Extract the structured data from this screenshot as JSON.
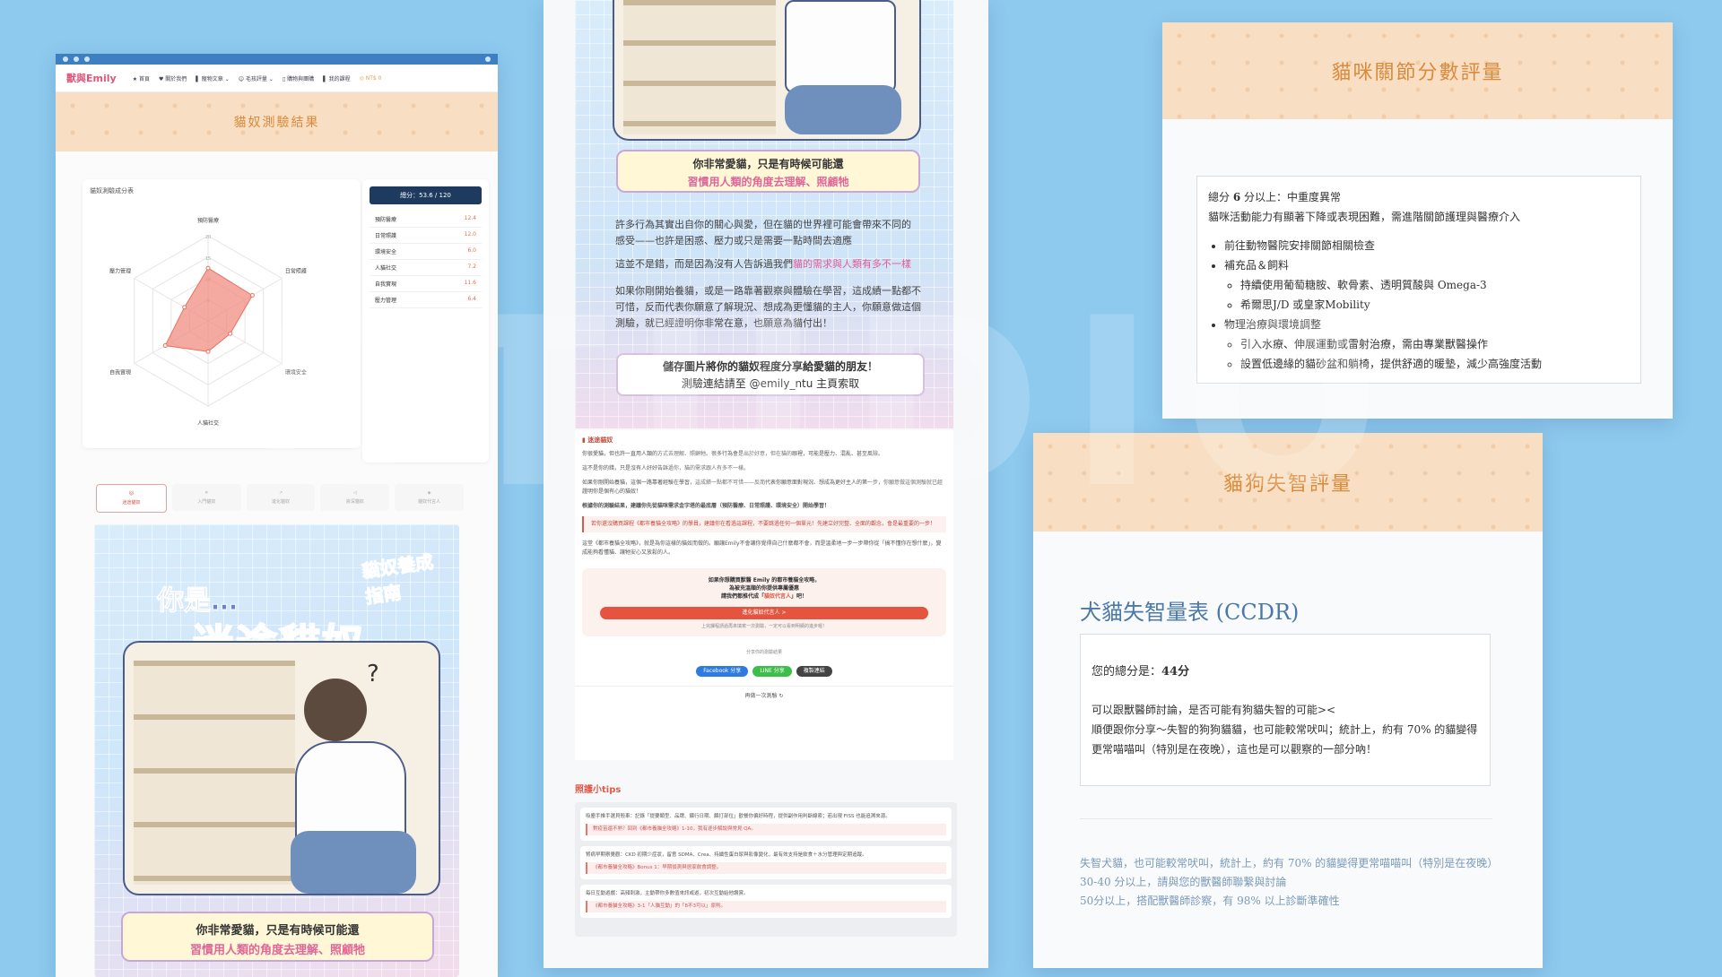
{
  "panel1": {
    "nav": {
      "logo": "獸與Emily",
      "items": [
        "★ 首頁",
        "♥ 關於我們",
        "▌ 寵物文章 ⌄",
        "☺ 毛孩評量 ⌄",
        "▯ 購物與團購",
        "▌ 我的課程",
        "◎ NT$ 0"
      ]
    },
    "banner_title": "貓奴測驗結果",
    "radar": {
      "title": "貓奴測驗成分表",
      "axes": [
        "預防醫療",
        "日常照護",
        "環境安全",
        "人貓社交",
        "自我實現",
        "壓力管理"
      ],
      "values": [
        12.4,
        12.0,
        6.0,
        7.2,
        11.6,
        6.4
      ],
      "max": 20,
      "ticks": [
        "20",
        "15",
        "10",
        "5"
      ]
    },
    "score_total": "總分：53.6 / 120",
    "scores": [
      {
        "label": "預防醫療",
        "value": "12.4"
      },
      {
        "label": "日常照護",
        "value": "12.0"
      },
      {
        "label": "環境安全",
        "value": "6.0"
      },
      {
        "label": "人貓社交",
        "value": "7.2"
      },
      {
        "label": "自我實現",
        "value": "11.6"
      },
      {
        "label": "壓力管理",
        "value": "6.4"
      }
    ],
    "tabs": [
      "迷途貓奴",
      "入門貓奴",
      "進化貓奴",
      "資深貓奴",
      "貓奴代言人"
    ],
    "illus_title_small": "你是…",
    "illus_title_big": "迷途貓奴",
    "illus_badge": "貓奴養成指南",
    "speech_line1": "你非常愛貓，只是有時候可能還",
    "speech_line2": "習慣用人類的角度去理解、照顧牠"
  },
  "panel2": {
    "speech_line1": "你非常愛貓，只是有時候可能還",
    "speech_line2": "習慣用人類的角度去理解、照顧牠",
    "para1": "許多行為其實出自你的關心與愛，但在貓的世界裡可能會帶來不同的感受——也許是困惑、壓力或只是需要一點時間去適應",
    "para2_a": "這並不是錯，而是因為沒有人告訴過我們",
    "para2_b": "貓的需求與人類有多不一樣",
    "para3": "如果你剛開始養貓，或是一路靠著觀察與體驗在學習，這成績一點都不可惜，反而代表你願意了解現況、想成為更懂貓的主人，你願意做這個測驗，就已經證明你非常在意，也願意為貓付出！",
    "share_line1": "儲存圖片將你的貓奴程度分享給愛貓的朋友！",
    "share_line2": "測驗連結請至 @emily_ntu 主頁索取",
    "section_title": "迷途貓奴",
    "small_paras": [
      "你很愛貓，但也許一直用人類的方式去理解、照顧牠。很多行為會是出於好意，但在貓的眼裡，可能是壓力、混亂、甚至風險。",
      "這不是你的錯，只是沒有人好好告訴過你，貓的需求跟人有多不一樣。",
      "如果你剛開始養貓，這個一路靠著經驗在學習，這成績一點都不可惜——反而代表你願意面對現況、想成為更好主人的第一步，你願意做這個測驗就已經證明你是個有心的貓奴！",
      "根據你的測驗結果，建議你先從貓咪需求金字塔的最底層（預防醫療、日常照護、環境安全）開始學習！"
    ],
    "redbar_text": "若你還沒購買課程《都市養貓全攻略》的學員，建議你在看過這課程，不要跳過任何一個單元！先建立好完整、全面的觀念，會是最重要的一步！",
    "small_para_after": "這堂《都市養貓全攻略》，就是為你這樣的貓奴而做的。願讓Emily不會讓你覺得自己什麼都不會，而是溫柔地一步一步帶你從「搞不懂你在想什麼」，變成能夠看懂貓、讓牠安心又放鬆的人。",
    "cta_line1": "如果你想購買獸醫 Emily 的都市養貓全攻略，",
    "cta_line2": "為被充溫順的你提供專屬優惠",
    "cta_line3_a": "請我們都推代成「",
    "cta_line3_b": "貓奴代言人",
    "cta_line3_c": "」吧！",
    "cta_button": "進化貓奴代言人 >",
    "cta_note": "上完課程請過再來填寫一次測驗，一定可以看到明顯的進步喔！",
    "share_label": "分享你的測驗結果",
    "share_buttons": [
      "Facebook 分享",
      "LINE 分享",
      "複製連結"
    ],
    "retry": "再做一次測驗 ↻",
    "tips_title": "照護小tips",
    "tips": [
      {
        "text": "吸塵手推手選貝殼車：記錄「提要類型、品牌、餵行日期、餵打部位」歡餐你偏好時程，提供副作用判斷線索；若出現 FISS 也能追溯來源。",
        "link": "對疫苗還不熟？回到《都市養貓全攻略》1-10，我有逐步解說與常見 QA。"
      },
      {
        "text": "腎病早期察覺觀：CKD 初期少症狀，留意 SDMA、Crea、持續性蛋白尿與影像變化，最有效支持是飲食＋水分管理與定期追蹤。",
        "link": "《都市養貓全攻略》Bonus 1：早期偵測與居家飲食調整。"
      },
      {
        "text": "每日互動遊戲：高頻刺激，主動帶你多數值來訊或遊，初次互動給他讚賞。",
        "link": "《都市養貓全攻略》3-1「人貓互動」的「8不3可以」原則。"
      }
    ]
  },
  "panel3": {
    "banner_title": "貓咪關節分數評量",
    "summary_a": "總分 ",
    "summary_num": "6",
    "summary_b": " 分以上：中重度異常",
    "summary_line2": "貓咪活動能力有顯著下降或表現困難，需進階關節護理與醫療介入",
    "bullets": {
      "b1": "前往動物醫院安排關節相關檢查",
      "b2": "補充品＆飼料",
      "b2a": "持續使用葡萄糖胺、軟骨素、透明質酸與 Omega-3",
      "b2b": "希爾思J/D 或皇家Mobility",
      "b3": "物理治療與環境調整",
      "b3a": "引入水療、伸展運動或雷射治療，需由專業獸醫操作",
      "b3b": "設置低邊緣的貓砂盆和躺椅，提供舒適的暖墊，減少高強度活動"
    }
  },
  "panel4": {
    "banner_title": "貓狗失智評量",
    "heading": "犬貓失智量表 (CCDR)",
    "score_label": "您的總分是：",
    "score_value": "44分",
    "body_line1": "可以跟獸醫師討論，是否可能有狗貓失智的可能><",
    "body_line2": "順便跟你分享～失智的狗狗貓貓，也可能較常吠叫；統計上，約有 70% 的貓變得更常喵喵叫（特別是在夜晚），這也是可以觀察的一部分吶！",
    "footer_lines": [
      "失智犬貓，也可能較常吠叫，統計上，約有 70% 的貓變得更常喵喵叫（特別是在夜晚）",
      "30-40 分以上，請與您的獸醫師聯繫與討論",
      "50分以上，搭配獸醫師診察，有 98% 以上診斷準確性"
    ]
  },
  "colors": {
    "background": "#8ec9ee",
    "banner": "#f8dfc4",
    "banner_text": "#d98a3b",
    "accent_pink": "#e05a9a",
    "accent_red": "#e5543e",
    "navy": "#1f3a5f",
    "heading_blue": "#4a78a8"
  }
}
